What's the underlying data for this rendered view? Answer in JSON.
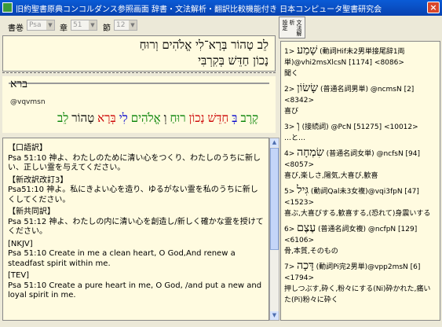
{
  "window": {
    "title": "旧約聖書原典コンコルダンス参照画面  辞書・文法解析・翻訳比較機能付き  日本コンピュータ聖書研究会",
    "close_glyph": "×"
  },
  "toolbar": {
    "book_label": "書巻",
    "book_value": "Psa",
    "chapter_label": "章",
    "chapter_value": "51",
    "verse_label": "節",
    "verse_value": "12",
    "dict_button_line1": "設定",
    "dict_button_line2": "文法解析"
  },
  "verse": {
    "hebrew_line1": "לֵב טָהוֹר בְּרָא־לִי אֱלֹהִים וְרוּחַ",
    "hebrew_line2": "נָכוֹן חַדֵּשׁ בְּקִרְבִּי"
  },
  "word": {
    "hebrew": "ברא",
    "parse": "@vqvmsn",
    "colored_words": [
      {
        "text": "לֵב",
        "color": "#008000"
      },
      {
        "text": "טָהוֹר",
        "color": "#000000"
      },
      {
        "text": "בְּרָא",
        "color": "#cc0000"
      },
      {
        "text": "לִי",
        "color": "#0000cc"
      },
      {
        "text": "אֱלֹהִים",
        "color": "#008000"
      },
      {
        "text": "וְ",
        "color": "#000000"
      },
      {
        "text": "רוּחַ",
        "color": "#008000"
      },
      {
        "text": "נָכוֹן",
        "color": "#cc0000"
      },
      {
        "text": "חַדֵּשׁ",
        "color": "#cc0000"
      },
      {
        "text": "בְּ",
        "color": "#0000cc"
      },
      {
        "text": "קֶרֶב",
        "color": "#008000"
      }
    ]
  },
  "translations": [
    {
      "label": "【口語訳】",
      "text": "Psa 51:10 神よ、わたしのために清い心をつくり、わたしのうちに新しい、正しい霊を与えてください。"
    },
    {
      "label": "【新改訳改訂3】",
      "text": "Psa51:10 神よ。私にきよい心を造り、ゆるがない霊を私のうちに新しくしてください。"
    },
    {
      "label": "【新共同訳】",
      "text": "Psa 51:12 神よ、わたしの内に清い心を創造し/新しく確かな霊を授けてください。"
    },
    {
      "label": "[NKJV]",
      "text": "Psa 51:10 Create in me a clean heart, O God,And renew a steadfast spirit within me."
    },
    {
      "label": "[TEV]",
      "text": "Psa 51:10 Create a pure heart in me, O God, /and put a new and loyal spirit in me."
    }
  ],
  "lexicon": [
    {
      "num": "1>",
      "heb": "שָׁמַע",
      "head": "(動詞Hif未2男単接尾辞1両単)@vhi2msXlcsN [1174] <8086>",
      "body": "聞く"
    },
    {
      "num": "2>",
      "heb": "שָׂשׂוֹן",
      "head": "(普通名詞男単) @ncmsN [2]",
      "body": "<8342>\n喜び"
    },
    {
      "num": "3>",
      "heb": "וְ",
      "head": "(接続詞) @PcN [51275] <10012>",
      "body": "…と…"
    },
    {
      "num": "4>",
      "heb": "שִׂמְחָה",
      "head": "(普通名詞女単) @ncfsN [94]",
      "body": "<8057>\n喜び,楽しさ,陽気,大喜び,歓喜"
    },
    {
      "num": "5>",
      "heb": "גִּיל",
      "head": "(動詞Qal未3女複)@vqi3fpN [47]",
      "body": "<1523>\n喜ぶ,大喜びする,歓喜する,(恐れて)身震いする"
    },
    {
      "num": "6>",
      "heb": "עֶצֶם",
      "head": "(普通名詞女複) @ncfpN [129]",
      "body": "<6106>\n骨,本質,そのもの"
    },
    {
      "num": "7>",
      "heb": "דָּכָה",
      "head": "(動詞Pi完2男単)@vpp2msN [6]",
      "body": "<1794>\n押しつぶす,砕く,粉々にする(Ni)砕かれた,痛いた(Pi)粉々に砕く"
    }
  ]
}
